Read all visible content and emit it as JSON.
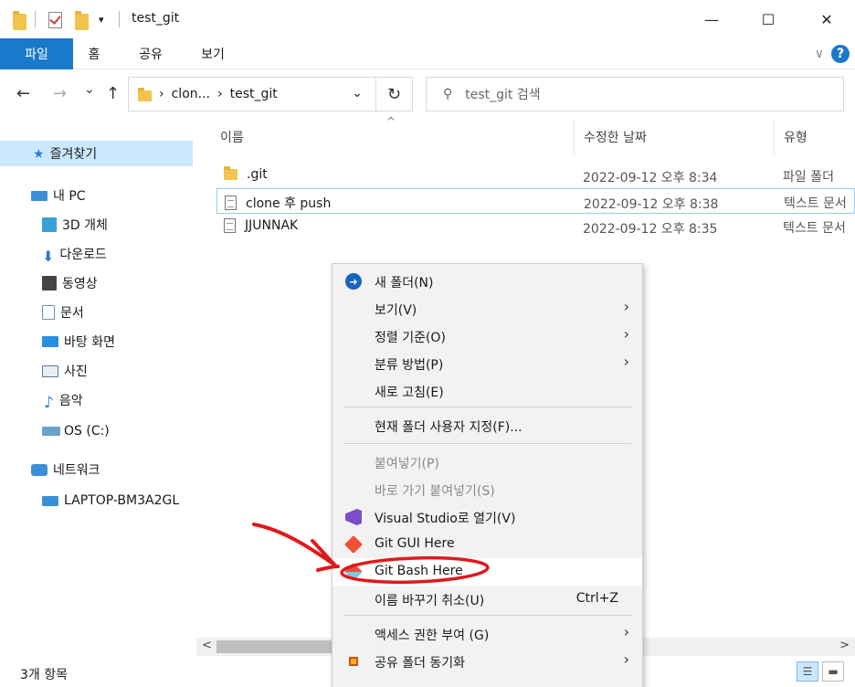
{
  "window": {
    "title": "test_git",
    "minimize_glyph": "—",
    "maximize_glyph": "☐",
    "close_glyph": "✕"
  },
  "ribbon": {
    "tabs": [
      "파일",
      "홈",
      "공유",
      "보기"
    ],
    "expand_glyph": "∨",
    "help_glyph": "?"
  },
  "nav": {
    "back_glyph": "←",
    "forward_glyph": "→",
    "recent_glyph": "⌄",
    "up_glyph": "↑",
    "breadcrumb": [
      "clon...",
      "test_git"
    ],
    "breadcrumb_sep": "›",
    "dropdown_glyph": "⌄",
    "refresh_glyph": "↻",
    "search_placeholder": "test_git 검색"
  },
  "sidebar": {
    "items": [
      {
        "label": "즐겨찾기",
        "icon": "star-icon",
        "color": "#2a7fd4"
      },
      {
        "label": "내 PC",
        "icon": "pc-icon",
        "color": "#3a8fd8"
      },
      {
        "label": "3D 개체",
        "icon": "cube-3d-icon",
        "color": "#39a0d8"
      },
      {
        "label": "다운로드",
        "icon": "download-icon",
        "color": "#2f7bd1"
      },
      {
        "label": "동영상",
        "icon": "video-icon",
        "color": "#444444"
      },
      {
        "label": "문서",
        "icon": "document-icon",
        "color": "#6f8fb0"
      },
      {
        "label": "바탕 화면",
        "icon": "desktop-icon",
        "color": "#2b8de0"
      },
      {
        "label": "사진",
        "icon": "pictures-icon",
        "color": "#5e7d9a"
      },
      {
        "label": "음악",
        "icon": "music-icon",
        "color": "#2a7fd4"
      },
      {
        "label": "OS (C:)",
        "icon": "drive-icon",
        "color": "#6aa1c8"
      },
      {
        "label": "네트워크",
        "icon": "network-icon",
        "color": "#3a8fd8"
      },
      {
        "label": "LAPTOP-BM3A2GL",
        "icon": "computer-icon",
        "color": "#3a8fd8"
      }
    ]
  },
  "columns": {
    "name": "이름",
    "date": "수정한 날짜",
    "type": "유형",
    "sort_glyph": "^"
  },
  "files": [
    {
      "name": ".git",
      "date": "2022-09-12 오후 8:34",
      "type": "파일 폴더",
      "kind": "folder"
    },
    {
      "name": "clone 후 push",
      "date": "2022-09-12 오후 8:38",
      "type": "텍스트 문서",
      "kind": "text"
    },
    {
      "name": "JJUNNAK",
      "date": "2022-09-12 오후 8:35",
      "type": "텍스트 문서",
      "kind": "text"
    }
  ],
  "scroll": {
    "left_glyph": "<",
    "right_glyph": ">"
  },
  "status": {
    "item_count": "3개 항목"
  },
  "context_menu": {
    "items": [
      {
        "label": "새 폴더(N)",
        "icon": "new-folder-icon"
      },
      {
        "label": "보기(V)",
        "submenu": "›"
      },
      {
        "label": "정렬 기준(O)",
        "submenu": "›"
      },
      {
        "label": "분류 방법(P)",
        "submenu": "›"
      },
      {
        "label": "새로 고침(E)"
      },
      {
        "label": "현재 폴더 사용자 지정(F)..."
      },
      {
        "label": "붙여넣기(P)",
        "disabled": true
      },
      {
        "label": "바로 가기 붙여넣기(S)",
        "disabled": true
      },
      {
        "label": "Visual Studio로 열기(V)",
        "icon": "visual-studio-icon"
      },
      {
        "label": "Git GUI Here",
        "icon": "git-gui-icon"
      },
      {
        "label": "Git Bash Here",
        "icon": "git-bash-icon"
      },
      {
        "label": "이름 바꾸기 취소(U)",
        "shortcut": "Ctrl+Z"
      },
      {
        "label": "액세스 권한 부여 (G)",
        "submenu": "›"
      },
      {
        "label": "공유 폴더 동기화",
        "icon": "sync-folder-icon",
        "submenu": "›"
      }
    ]
  },
  "annotation_color": "#e0191b"
}
